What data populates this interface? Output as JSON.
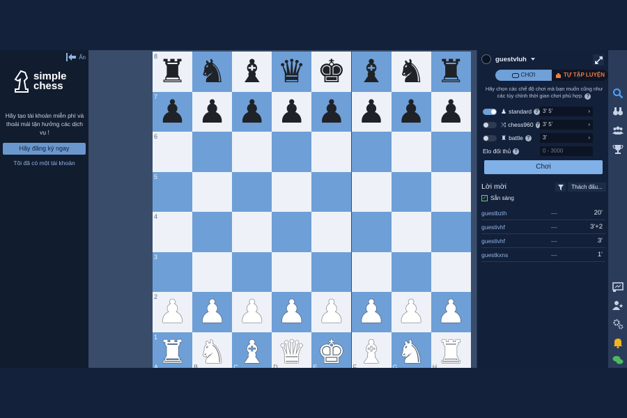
{
  "left_panel": {
    "hide_label": "Ẩn",
    "logo_line1": "simple",
    "logo_line2": "chess",
    "message": "Hãy tạo tài khoản miễn phí và thoải mái tận hưởng các dịch vụ !",
    "signup_button": "Hãy đăng ký ngay",
    "have_account_link": "Tôi đã có một tài khoản"
  },
  "board": {
    "rank_labels": [
      "8",
      "7",
      "6",
      "5",
      "4",
      "3",
      "2",
      "1"
    ],
    "file_labels": [
      "A",
      "B",
      "C",
      "D",
      "E",
      "F",
      "G",
      "H"
    ],
    "pieces_rank8": [
      "♜",
      "♞",
      "♝",
      "♛",
      "♚",
      "♝",
      "♞",
      "♜"
    ],
    "pieces_rank7": [
      "♟",
      "♟",
      "♟",
      "♟",
      "♟",
      "♟",
      "♟",
      "♟"
    ],
    "pieces_rank2": [
      "♟",
      "♟",
      "♟",
      "♟",
      "♟",
      "♟",
      "♟",
      "♟"
    ],
    "pieces_rank1": [
      "♜",
      "♞",
      "♝",
      "♛",
      "♚",
      "♝",
      "♞",
      "♜"
    ],
    "colors": {
      "light": "#eef2f8",
      "dark": "#6e9fd7"
    }
  },
  "right_panel": {
    "username": "guestvluh",
    "tabs": [
      {
        "label": "CHƠI",
        "icon": "game-controller-icon"
      },
      {
        "label": "TỰ TẬP LUYỆN",
        "icon": "puzzle-icon"
      }
    ],
    "hint": "Hãy chọn các chế độ chơi mà bạn muốn cũng như các tùy chỉnh thời gian chơi phù hợp.",
    "hint_q": "?",
    "modes": [
      {
        "name": "standard",
        "time": "3' 5'",
        "enabled": true,
        "icon": "pawn-icon"
      },
      {
        "name": "chess960",
        "time": "3' 5'",
        "enabled": false,
        "icon": "shuffle-icon"
      },
      {
        "name": "battle",
        "time": "3'",
        "enabled": false,
        "icon": "battle-icon"
      }
    ],
    "elo_label": "Elo đối thủ",
    "elo_value": "0 - 3000",
    "play_button": "Chơi",
    "invitations_title": "Lời mời",
    "challenge_button": "Thách đấu...",
    "ready_label": "Sẵn sàng",
    "ready_check": "✓",
    "invitations": [
      {
        "player": "guestbzih",
        "dash": "—",
        "time": "20'"
      },
      {
        "player": "guestivhf",
        "dash": "—",
        "time": "3'+2"
      },
      {
        "player": "guestivhf",
        "dash": "—",
        "time": "3'"
      },
      {
        "player": "guestkxns",
        "dash": "—",
        "time": "1'"
      }
    ]
  },
  "icon_column": [
    "search-icon",
    "binoculars-icon",
    "users-icon",
    "trophy-icon",
    "chat-board-icon",
    "user-star-icon",
    "settings-icon",
    "bell-icon",
    "chat-icon"
  ]
}
